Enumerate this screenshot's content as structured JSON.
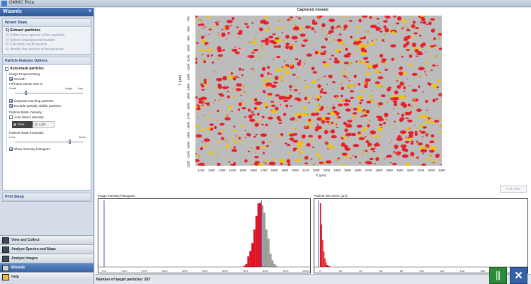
{
  "window": {
    "title": "OMNIC Picta"
  },
  "wizard": {
    "header": "Wizards",
    "steps_title": "Wizard Steps",
    "steps": [
      "1) Extract particles",
      "2)  Collect new spectra of the particles",
      "3)  Select a background location",
      "4)  Calculate result spectra",
      "5)  Identify the spectra of the particles"
    ],
    "analysis_title": "Particle Analysis Options",
    "automask_label": "Auto-mask particles",
    "image_preproc_label": "Image Preprocessing",
    "smooth_label": "Smooth",
    "fill_holes_label": "Fill holes whose size is:",
    "fill_ticks": [
      "Small",
      "Large",
      "Any"
    ],
    "fill_level": 0.15,
    "separate_label": "Separate touching particles",
    "exclude_label": "Exclude partially visible particles",
    "mask_intensity_label": "Particle Mask Intensity",
    "autodetect_label": "Auto-detect intensity",
    "dark_label": "Dark",
    "light_label": "Light",
    "threshold_label": "Particle mask threshold:",
    "threshold_ticks": [
      "Less",
      "More"
    ],
    "threshold_level": 0.82,
    "histogram_label": "Show intensity histogram",
    "print_setup": "Print Setup",
    "nav": [
      "View and Collect",
      "Analyze Spectra and Maps",
      "Analyze Images",
      "Wizards",
      "Help"
    ]
  },
  "mosaic": {
    "title": "Captured mosaic",
    "xlabel": "X (µm)",
    "ylabel": "Y (µm)",
    "xticks": [
      "1100",
      "1200",
      "1300",
      "1400",
      "1500",
      "1600",
      "1700",
      "1800",
      "1900",
      "2000",
      "2100",
      "2200",
      "2300",
      "2400",
      "2500",
      "2600",
      "2700",
      "2800",
      "2900",
      "3000",
      "3100",
      "3200",
      "3300",
      "3400"
    ],
    "yticks": [
      "-700",
      "-800",
      "-900",
      "-1000",
      "-1100",
      "-1200",
      "-1300",
      "-1400",
      "-1500",
      "-1600",
      "-1700",
      "-1800",
      "-1900",
      "-2000",
      "-2100",
      "-2200"
    ]
  },
  "full_view_label": "Full View",
  "hist1": {
    "title": "Image intensity histogram:",
    "xticks": [
      "0%",
      "10%",
      "20%",
      "30%",
      "40%",
      "50%",
      "60%",
      "70%",
      "80%",
      "90%",
      "100%"
    ]
  },
  "hist2": {
    "title": "Particle size sieve  (µm):",
    "xticks": [
      "0",
      "20",
      "40",
      "60",
      "80",
      "100",
      "120",
      "140",
      "160",
      "180",
      "200"
    ]
  },
  "status": {
    "count": "Number of target particles: 257"
  },
  "colors": {
    "particle_red": "#e8202a",
    "particle_yellow": "#f2c300",
    "background_gray": "#bcbcbc",
    "accent_blue": "#3b64a4"
  }
}
